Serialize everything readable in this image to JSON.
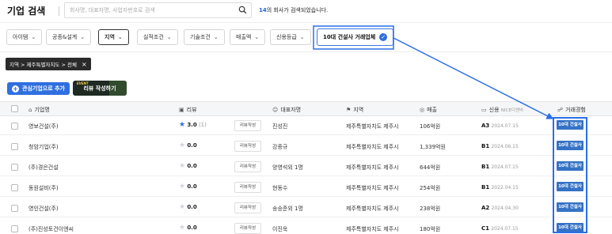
{
  "header": {
    "title": "기업 검색",
    "search_placeholder": "회사명, 대표자명, 사업자번호로 검색",
    "result_count": "14",
    "result_suffix": "의 회사가 검색되었습니다."
  },
  "filters": [
    {
      "label": "아이템",
      "active": false
    },
    {
      "label": "공종&설계",
      "active": false
    },
    {
      "label": "지역",
      "active": true
    },
    {
      "label": "실적조건",
      "active": false
    },
    {
      "label": "기술조건",
      "active": false
    },
    {
      "label": "매출액",
      "active": false
    },
    {
      "label": "신용등급",
      "active": false
    }
  ],
  "special_filter": {
    "label": "10대 건설사 거래업체"
  },
  "chip": {
    "label": "지역 > 제주특별자치도 > 전체"
  },
  "actions": {
    "add_fav": "관심기업으로 추가",
    "review_event": "EVENT",
    "review": "리뷰 작성하기"
  },
  "table": {
    "headers": [
      "기업명",
      "리뷰",
      "대표자명",
      "지역",
      "매출",
      "신용",
      "NICE디앤비",
      "거래경험"
    ],
    "rows": [
      {
        "name": "영보건설(주)",
        "rating": "3.0",
        "rating_count": "(1)",
        "star_filled": true,
        "review_btn": "리뷰작성",
        "ceo": "진성진",
        "region": "제주특별자치도 제주시",
        "sales": "106억원",
        "grade": "A3",
        "grade_date": "2024.07.15",
        "badge": "10대 건설사"
      },
      {
        "name": "청암기업(주)",
        "rating": "0.0",
        "rating_count": "",
        "star_filled": false,
        "review_btn": "리뷰작성",
        "ceo": "강종규",
        "region": "제주특별자치도 제주시",
        "sales": "1,339억원",
        "grade": "B1",
        "grade_date": "2024.06.15",
        "badge": "10대 건설사"
      },
      {
        "name": "(주)경은건설",
        "rating": "0.0",
        "rating_count": "",
        "star_filled": false,
        "review_btn": "리뷰작성",
        "ceo": "양영석외 1명",
        "region": "제주특별자치도 제주시",
        "sales": "644억원",
        "grade": "B1",
        "grade_date": "2024.07.15",
        "badge": "10대 건설사"
      },
      {
        "name": "동원설비(주)",
        "rating": "0.0",
        "rating_count": "",
        "star_filled": false,
        "review_btn": "리뷰작성",
        "ceo": "현동수",
        "region": "제주특별자치도 제주시",
        "sales": "254억원",
        "grade": "B1",
        "grade_date": "2022.04.15",
        "badge": "10대 건설사"
      },
      {
        "name": "영인건설(주)",
        "rating": "0.0",
        "rating_count": "",
        "star_filled": false,
        "review_btn": "리뷰작성",
        "ceo": "송승준외 1명",
        "region": "제주특별자치도 제주시",
        "sales": "238억원",
        "grade": "A2",
        "grade_date": "2024.04.30",
        "badge": "10대 건설사"
      },
      {
        "name": "(주)진성토건이엔씨",
        "rating": "0.0",
        "rating_count": "",
        "star_filled": false,
        "review_btn": "리뷰작성",
        "ceo": "이진욱",
        "region": "제주특별자치도 제주시",
        "sales": "180억원",
        "grade": "C1",
        "grade_date": "2024.07.15",
        "badge": "10대 건설사"
      }
    ]
  },
  "colors": {
    "accent": "#2f6fe0",
    "badge": "#3572c6",
    "highlight": "#2b6fe8"
  }
}
